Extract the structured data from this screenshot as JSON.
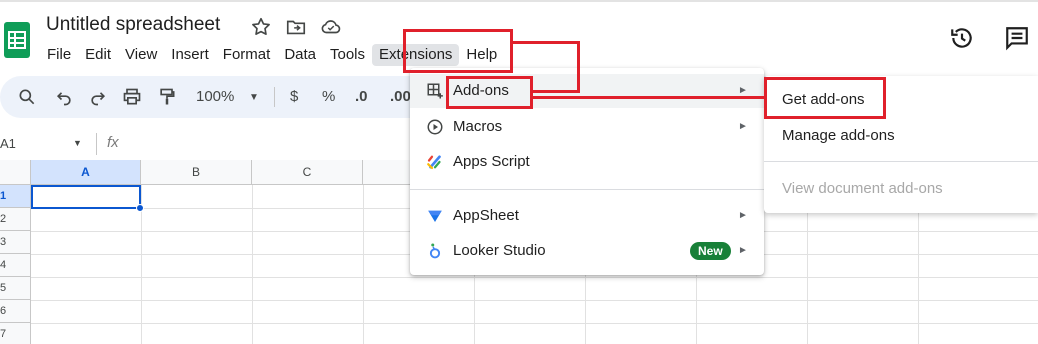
{
  "app": {
    "title": "Untitled spreadsheet"
  },
  "menubar": {
    "items": [
      "File",
      "Edit",
      "View",
      "Insert",
      "Format",
      "Data",
      "Tools",
      "Extensions",
      "Help"
    ]
  },
  "toolbar": {
    "zoom": "100%",
    "currency": "$",
    "percent": "%",
    "decrease_decimal": ".0",
    "increase_decimal": ".00"
  },
  "formula_bar": {
    "name_box": "A1",
    "fx": "fx"
  },
  "grid": {
    "columns": [
      "A",
      "B",
      "C"
    ],
    "rows": [
      "1",
      "2",
      "3",
      "4",
      "5",
      "6",
      "7"
    ],
    "selected_cell": "A1"
  },
  "extensions_menu": {
    "items": [
      {
        "label": "Add-ons",
        "icon": "add-ons-icon",
        "has_submenu": true
      },
      {
        "label": "Macros",
        "icon": "play-circle-icon",
        "has_submenu": true
      },
      {
        "label": "Apps Script",
        "icon": "apps-script-icon",
        "has_submenu": false
      },
      {
        "label": "AppSheet",
        "icon": "appsheet-icon",
        "has_submenu": true
      },
      {
        "label": "Looker Studio",
        "icon": "looker-studio-icon",
        "has_submenu": true,
        "badge": "New"
      }
    ]
  },
  "addons_submenu": {
    "items": [
      {
        "label": "Get add-ons",
        "disabled": false
      },
      {
        "label": "Manage add-ons",
        "disabled": false
      },
      {
        "label": "View document add-ons",
        "disabled": true
      }
    ]
  },
  "colors": {
    "sheets_green": "#0f9d58",
    "toolbar_bg": "#edf2fa",
    "selection_blue": "#0b57d0",
    "annotation_red": "#e0202b",
    "badge_green": "#188038"
  }
}
